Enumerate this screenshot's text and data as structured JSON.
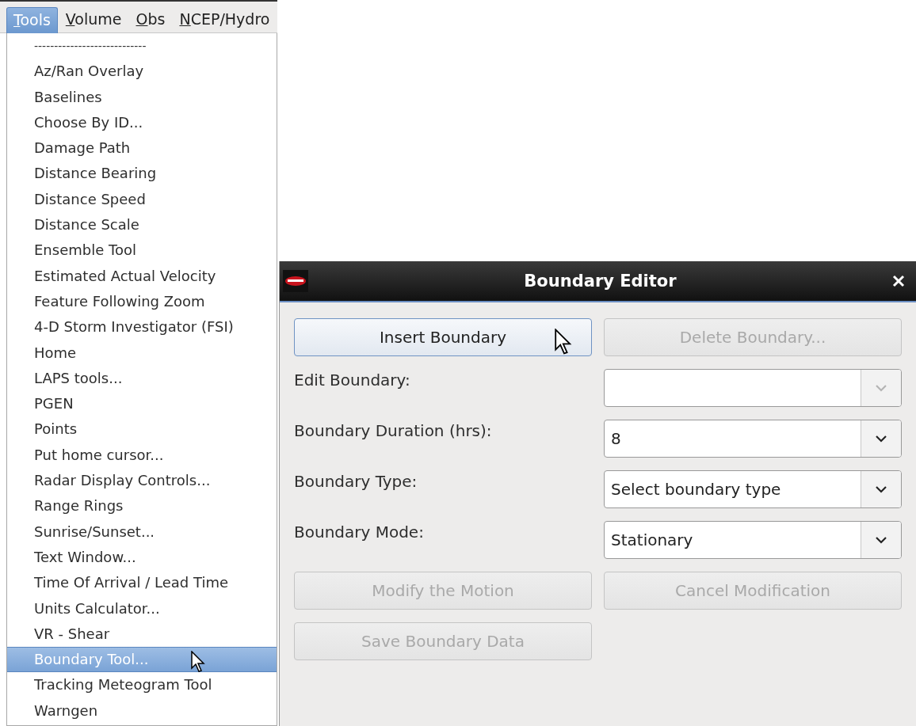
{
  "menubar": [
    {
      "label": "Tools",
      "selected": true
    },
    {
      "label": "Volume",
      "selected": false
    },
    {
      "label": "Obs",
      "selected": false
    },
    {
      "label": "NCEP/Hydro",
      "selected": false
    }
  ],
  "menu": {
    "items": [
      {
        "label": "----------------------------",
        "kind": "separator",
        "selected": false
      },
      {
        "label": "Az/Ran Overlay",
        "kind": "item",
        "selected": false
      },
      {
        "label": "Baselines",
        "kind": "item",
        "selected": false
      },
      {
        "label": "Choose By ID...",
        "kind": "item",
        "selected": false
      },
      {
        "label": "Damage Path",
        "kind": "item",
        "selected": false
      },
      {
        "label": "Distance Bearing",
        "kind": "item",
        "selected": false
      },
      {
        "label": "Distance Speed",
        "kind": "item",
        "selected": false
      },
      {
        "label": "Distance Scale",
        "kind": "item",
        "selected": false
      },
      {
        "label": "Ensemble Tool",
        "kind": "item",
        "selected": false
      },
      {
        "label": "Estimated Actual Velocity",
        "kind": "item",
        "selected": false
      },
      {
        "label": "Feature Following Zoom",
        "kind": "item",
        "selected": false
      },
      {
        "label": "4-D Storm Investigator (FSI)",
        "kind": "item",
        "selected": false
      },
      {
        "label": "Home",
        "kind": "item",
        "selected": false
      },
      {
        "label": "LAPS tools...",
        "kind": "item",
        "selected": false
      },
      {
        "label": "PGEN",
        "kind": "item",
        "selected": false
      },
      {
        "label": "Points",
        "kind": "item",
        "selected": false
      },
      {
        "label": "Put home cursor...",
        "kind": "item",
        "selected": false
      },
      {
        "label": "Radar Display Controls...",
        "kind": "item",
        "selected": false
      },
      {
        "label": "Range Rings",
        "kind": "item",
        "selected": false
      },
      {
        "label": "Sunrise/Sunset...",
        "kind": "item",
        "selected": false
      },
      {
        "label": "Text Window...",
        "kind": "item",
        "selected": false
      },
      {
        "label": "Time Of Arrival / Lead Time",
        "kind": "item",
        "selected": false
      },
      {
        "label": "Units Calculator...",
        "kind": "item",
        "selected": false
      },
      {
        "label": "VR - Shear",
        "kind": "item",
        "selected": false
      },
      {
        "label": "Boundary Tool...",
        "kind": "item",
        "selected": true
      },
      {
        "label": "Tracking Meteogram Tool",
        "kind": "item",
        "selected": false
      },
      {
        "label": "Warngen",
        "kind": "item",
        "selected": false
      }
    ]
  },
  "dialog": {
    "title": "Boundary Editor",
    "top_buttons": [
      {
        "label": "Insert Boundary",
        "disabled": false
      },
      {
        "label": "Delete Boundary...",
        "disabled": true
      }
    ],
    "fields": [
      {
        "label": "Edit Boundary:",
        "disabled": true
      },
      {
        "label": "Boundary Duration (hrs):",
        "value": "8",
        "disabled": false
      },
      {
        "label": "Boundary Type:",
        "value": "Select boundary type",
        "disabled": false
      },
      {
        "label": "Boundary Mode:",
        "value": "Stationary",
        "disabled": false
      }
    ],
    "bottom_buttons": [
      {
        "label": "Modify the Motion",
        "disabled": true
      },
      {
        "label": "Cancel Modification",
        "disabled": true
      },
      {
        "label": "Save Boundary Data",
        "disabled": true
      }
    ]
  }
}
